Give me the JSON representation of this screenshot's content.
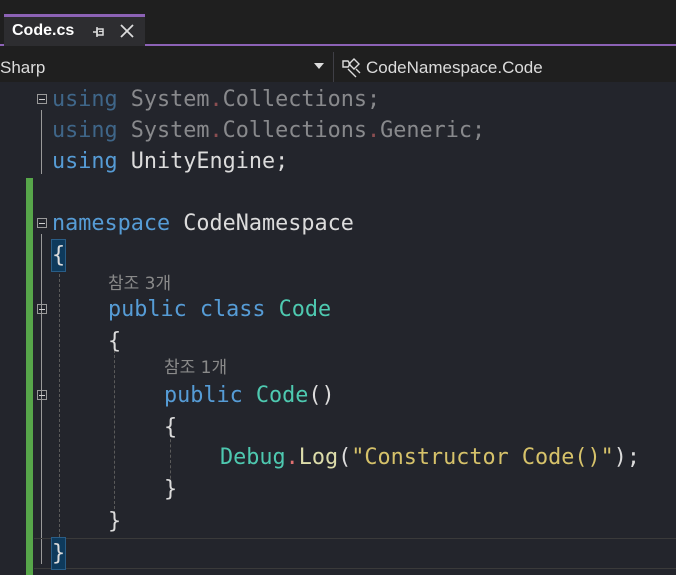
{
  "tab": {
    "title": "Code.cs",
    "pin_icon": "pin-icon",
    "close_icon": "close-icon"
  },
  "navbar": {
    "project": "Sharp",
    "member_icon": "namespace-icon",
    "member": "CodeNamespace.Code"
  },
  "code": {
    "using1_kw": "using",
    "using1_a": " System",
    "using1_b": "Collections;",
    "using2_kw": "using",
    "using2_a": " System",
    "using2_b": "Collections",
    "using2_c": "Generic;",
    "using3_kw": "using",
    "using3_a": " UnityEngine;",
    "ns_kw": "namespace",
    "ns_name": " CodeNamespace",
    "open_brace": "{",
    "close_brace": "}",
    "class_refs": "참조 3개",
    "class_kw1": "public",
    "class_kw2": " class",
    "class_name": " Code",
    "ctor_refs": "참조 1개",
    "ctor_kw": "public",
    "ctor_name": " Code",
    "ctor_parens": "()",
    "debug_type": "Debug",
    "debug_dot": ".",
    "debug_fn": "Log",
    "debug_open": "(",
    "debug_str": "\"Constructor Code()\"",
    "debug_close": ");"
  },
  "colors": {
    "accent": "#8c62b5",
    "keyword": "#569cd6",
    "type": "#4ec9b0",
    "string": "#d6c26a",
    "change_bar": "#57a64a"
  }
}
